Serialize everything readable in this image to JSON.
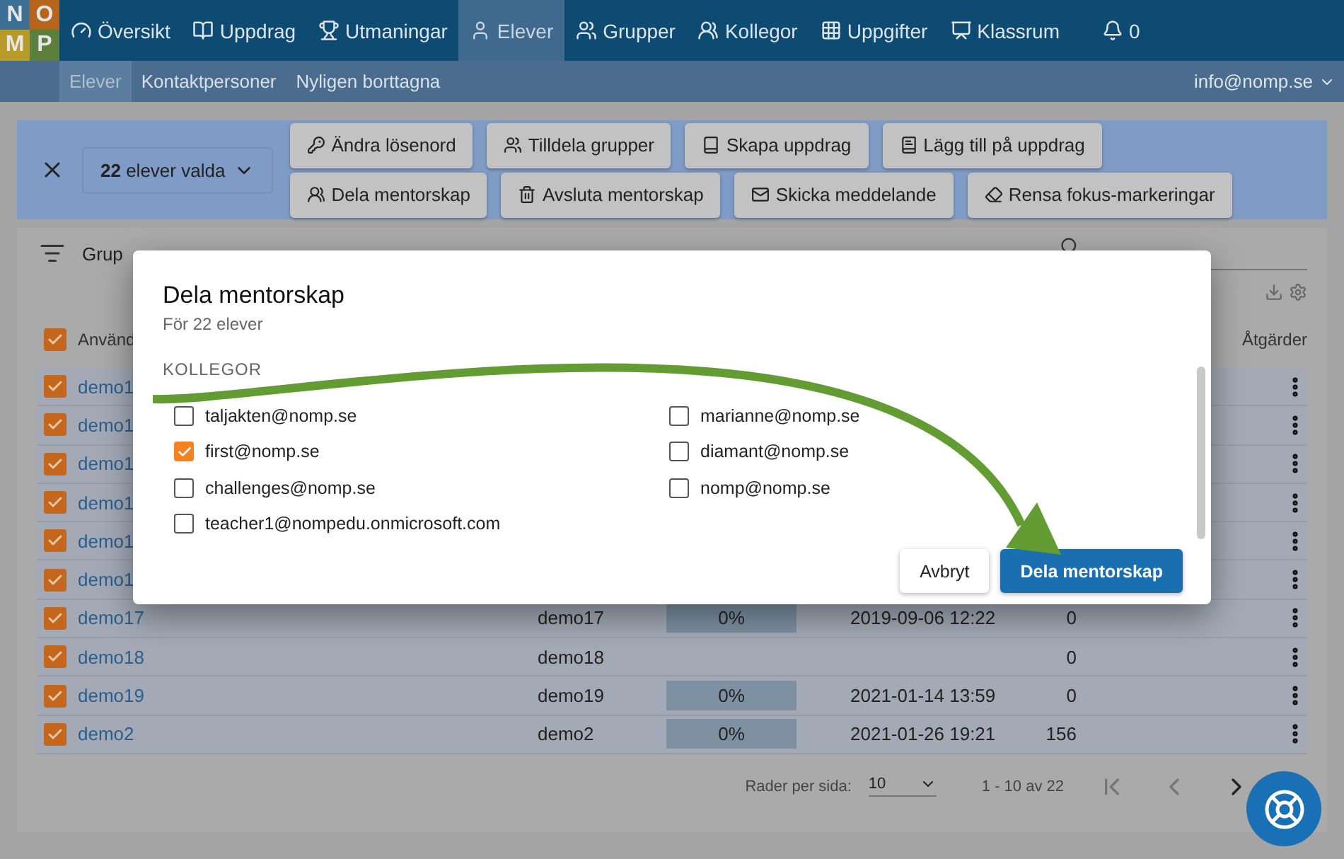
{
  "nav": {
    "logo": [
      "N",
      "O",
      "M",
      "P"
    ],
    "items": [
      {
        "label": "Översikt",
        "selected": false
      },
      {
        "label": "Uppdrag",
        "selected": false
      },
      {
        "label": "Utmaningar",
        "selected": false
      },
      {
        "label": "Elever",
        "selected": true
      },
      {
        "label": "Grupper",
        "selected": false
      },
      {
        "label": "Kollegor",
        "selected": false
      },
      {
        "label": "Uppgifter",
        "selected": false
      },
      {
        "label": "Klassrum",
        "selected": false
      },
      {
        "label": "0",
        "selected": false
      }
    ],
    "user": "info@nomp.se"
  },
  "subnav": [
    {
      "label": "Elever",
      "selected": true
    },
    {
      "label": "Kontaktpersoner",
      "selected": false
    },
    {
      "label": "Nyligen borttagna",
      "selected": false
    }
  ],
  "selection_bar": {
    "count": "**22** elever valda",
    "actions": [
      "Ändra lösenord",
      "Tilldela grupper",
      "Skapa uppdrag",
      "Lägg till på uppdrag",
      "Dela mentorskap",
      "Avsluta mentorskap",
      "Skicka meddelande",
      "Rensa fokus-markeringar"
    ]
  },
  "filter": {
    "label": "Grup"
  },
  "table": {
    "columns": [
      "Använd",
      "Åtgärder"
    ],
    "header_checked": true,
    "rows": [
      {
        "username": "demo1",
        "checked": true
      },
      {
        "username": "demo1",
        "checked": true
      },
      {
        "username": "demo1",
        "checked": true
      },
      {
        "username": "demo1",
        "checked": true
      },
      {
        "username": "demo1",
        "checked": true
      },
      {
        "username": "demo1",
        "checked": true
      },
      {
        "username": "demo17",
        "name": "demo17",
        "progress": "0%",
        "date": "2019-09-06 12:22",
        "count": "0",
        "checked": true
      },
      {
        "username": "demo18",
        "name": "demo18",
        "count": "0",
        "checked": true
      },
      {
        "username": "demo19",
        "name": "demo19",
        "progress": "0%",
        "date": "2021-01-14 13:59",
        "count": "0",
        "checked": true
      },
      {
        "username": "demo2",
        "name": "demo2",
        "progress": "0%",
        "date": "2021-01-26 19:21",
        "count": "156",
        "checked": true
      }
    ]
  },
  "pagination": {
    "rows_label": "Rader per sida:",
    "rows_value": "10",
    "range": "1 - 10 av 22"
  },
  "dialog": {
    "title": "Dela mentorskap",
    "subtitle": "För 22 elever",
    "section": "KOLLEGOR",
    "colleagues": [
      {
        "email": "taljakten@nomp.se",
        "checked": false
      },
      {
        "email": "first@nomp.se",
        "checked": true
      },
      {
        "email": "challenges@nomp.se",
        "checked": false
      },
      {
        "email": "teacher1@nompedu.onmicrosoft.com",
        "checked": false
      },
      {
        "email": "marianne@nomp.se",
        "checked": false
      },
      {
        "email": "diamant@nomp.se",
        "checked": false
      },
      {
        "email": "nomp@nomp.se",
        "checked": false
      }
    ],
    "buttons": [
      {
        "label": "Avbryt",
        "kind": "secondary"
      },
      {
        "label": "Dela mentorskap",
        "kind": "primary"
      }
    ]
  }
}
